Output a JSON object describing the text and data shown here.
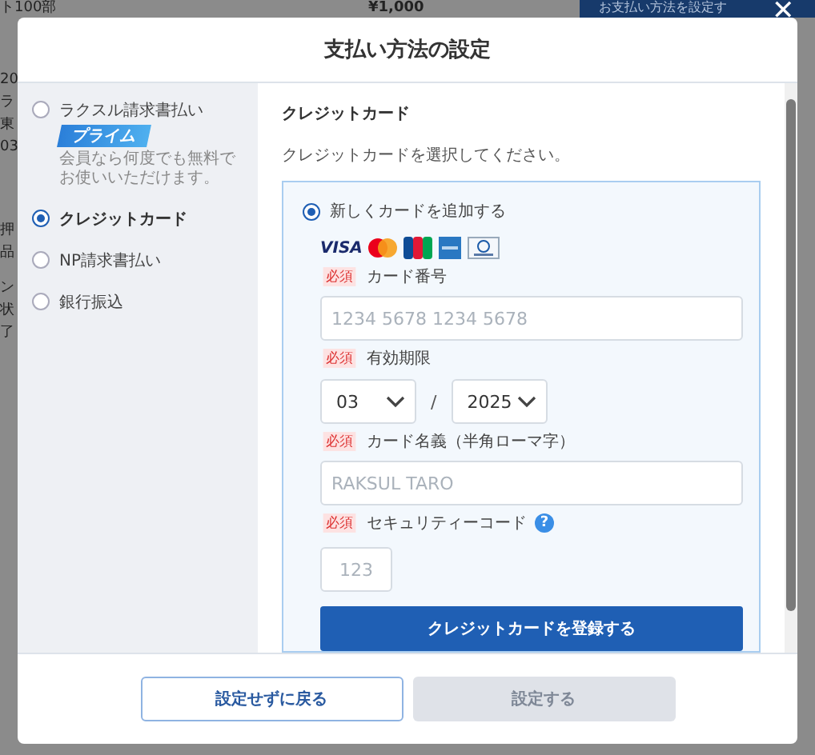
{
  "background_page": {
    "top_texts": [
      "ト100部",
      "¥1,000"
    ],
    "action_button": "お支払い方法を設定す",
    "side_texts": [
      "20",
      "ラ",
      "東",
      "03",
      "押",
      "品",
      "ン",
      "状",
      "了"
    ]
  },
  "dialog": {
    "title": "支払い方法の設定",
    "close": "✕"
  },
  "payment_methods": [
    {
      "label": "ラクスル請求書払い",
      "selected": false,
      "badge": "プライム",
      "note": "会員なら何度でも無料でお使いいただけます。"
    },
    {
      "label": "クレジットカード",
      "selected": true
    },
    {
      "label": "NP請求書払い",
      "selected": false
    },
    {
      "label": "銀行振込",
      "selected": false
    }
  ],
  "panel": {
    "title": "クレジットカード",
    "description": "クレジットカードを選択してください。",
    "option": {
      "label": "新しくカードを追加する",
      "selected": true
    },
    "brand_text": "VISA",
    "fields": [
      {
        "kind": "text",
        "badge": "必須",
        "label": "カード番号",
        "placeholder": "1234 5678 1234 5678"
      },
      {
        "kind": "expiry",
        "badge": "必須",
        "label": "有効期限",
        "month": "03",
        "separator": "/",
        "year": "2025"
      },
      {
        "kind": "text",
        "badge": "必須",
        "label": "カード名義（半角ローマ字）",
        "placeholder": "RAKSUL TARO"
      },
      {
        "kind": "code",
        "badge": "必須",
        "label": "セキュリティーコード",
        "help": "?",
        "placeholder": "123"
      }
    ],
    "submit": "クレジットカードを登録する"
  },
  "footer_buttons": [
    {
      "label": "設定せずに戻る",
      "kind": "secondary",
      "disabled": false
    },
    {
      "label": "設定する",
      "kind": "primary",
      "disabled": true
    }
  ]
}
